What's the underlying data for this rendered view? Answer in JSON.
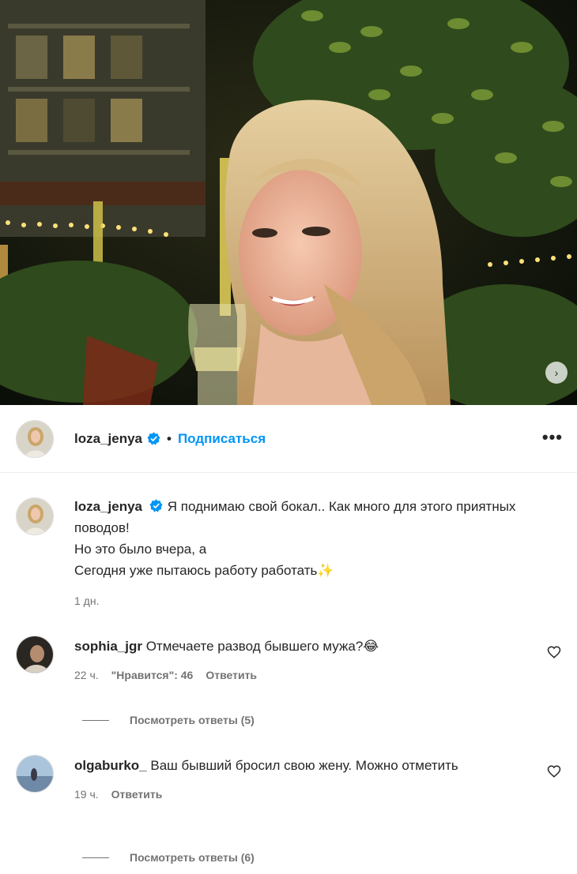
{
  "post": {
    "photo_icon": "carousel-next-icon",
    "header": {
      "username": "loza_jenya",
      "separator": "•",
      "follow_label": "Подписаться",
      "more_label": "•••"
    },
    "caption": {
      "username": "loza_jenya",
      "line1": "Я поднимаю свой бокал.. Как много для этого приятных поводов!",
      "line2": "Но это было вчера, а",
      "line3": "Сегодня уже пытаюсь работу работать✨",
      "time": "1 дн."
    }
  },
  "comments": [
    {
      "username": "sophia_jgr",
      "text": "Отмечаете развод бывшего мужа?😂",
      "time": "22 ч.",
      "likes": "\"Нравится\": 46",
      "reply_label": "Ответить",
      "view_replies": "Посмотреть ответы (5)"
    },
    {
      "username": "olgaburko_",
      "text": "Ваш бывший бросил свою жену. Можно отметить",
      "time": "19 ч.",
      "reply_label": "Ответить",
      "view_replies": "Посмотреть ответы (6)"
    }
  ],
  "colors": {
    "link": "#0095f6",
    "verified": "#0095f6",
    "secondary_text": "#737373"
  }
}
